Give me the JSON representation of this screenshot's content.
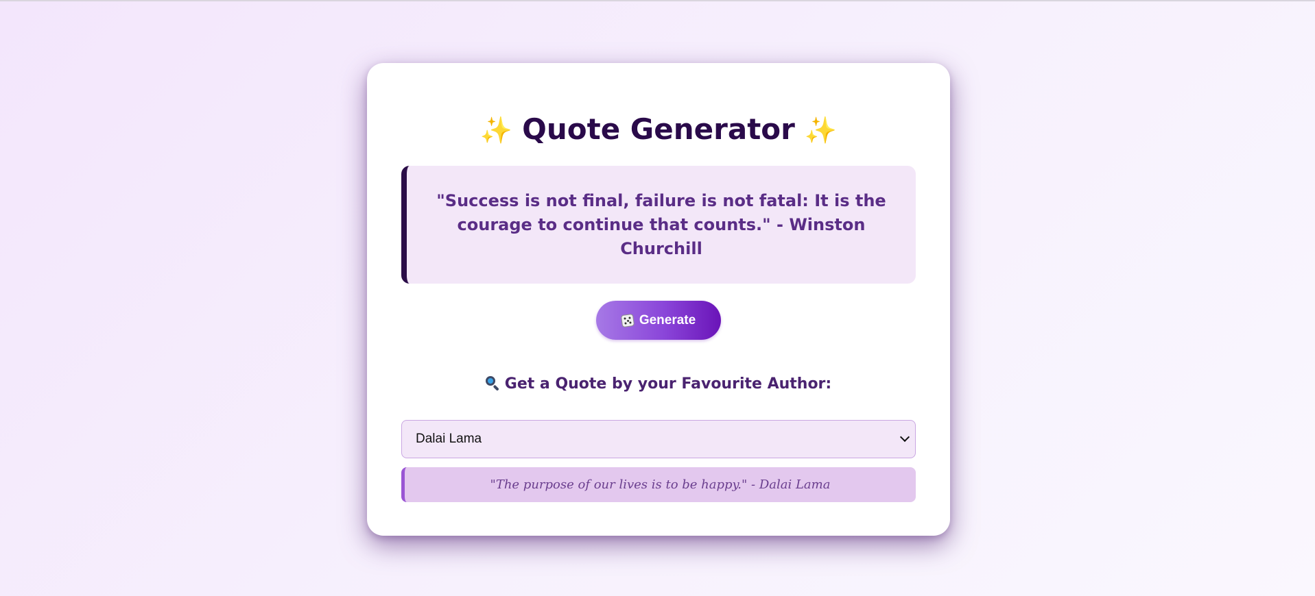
{
  "header": {
    "title": "Quote Generator",
    "sparkle_left": "✨",
    "sparkle_right": "✨"
  },
  "main_quote": {
    "text": "\"Success is not final, failure is not fatal: It is the courage to continue that counts.\" - Winston Churchill"
  },
  "generate_button": {
    "label": "Generate",
    "icon": "dice-icon"
  },
  "author_section": {
    "label": "Get a Quote by your Favourite Author:",
    "icon": "magnifying-glass-icon",
    "selected_author": "Dalai Lama",
    "author_quote": "\"The purpose of our lives is to be happy.\" - Dalai Lama"
  },
  "colors": {
    "title": "#2a0a4a",
    "quote_text": "#5a2d86",
    "accent_dark": "#2b0d48",
    "button_start": "#a679e6",
    "button_end": "#6a14b8",
    "sparkle": "#f6be2a"
  }
}
